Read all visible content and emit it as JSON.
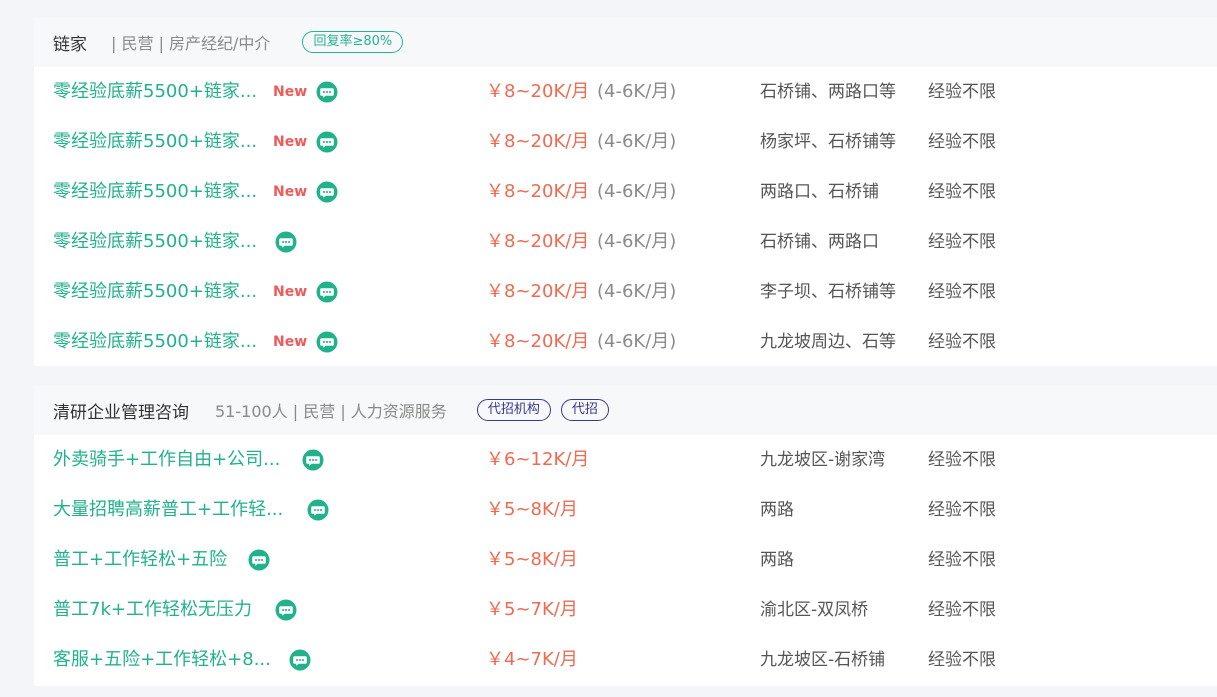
{
  "companies": [
    {
      "name": "链家",
      "info": "| 民营 | 房产经纪/中介",
      "tags": [
        "回复率≥80%"
      ],
      "jobs": [
        {
          "title": "零经验底薪5500+链家...",
          "new": "New",
          "salary": "￥8~20K/月",
          "salary_sub": "(4-6K/月)",
          "location": "石桥铺、两路口等",
          "experience": "经验不限"
        },
        {
          "title": "零经验底薪5500+链家...",
          "new": "New",
          "salary": "￥8~20K/月",
          "salary_sub": "(4-6K/月)",
          "location": "杨家坪、石桥铺等",
          "experience": "经验不限"
        },
        {
          "title": "零经验底薪5500+链家...",
          "new": "New",
          "salary": "￥8~20K/月",
          "salary_sub": "(4-6K/月)",
          "location": "两路口、石桥铺",
          "experience": "经验不限"
        },
        {
          "title": "零经验底薪5500+链家...",
          "new": "",
          "salary": "￥8~20K/月",
          "salary_sub": "(4-6K/月)",
          "location": "石桥铺、两路口",
          "experience": "经验不限"
        },
        {
          "title": "零经验底薪5500+链家...",
          "new": "New",
          "salary": "￥8~20K/月",
          "salary_sub": "(4-6K/月)",
          "location": "李子坝、石桥铺等",
          "experience": "经验不限"
        },
        {
          "title": "零经验底薪5500+链家...",
          "new": "New",
          "salary": "￥8~20K/月",
          "salary_sub": "(4-6K/月)",
          "location": "九龙坡周边、石等",
          "experience": "经验不限"
        }
      ]
    },
    {
      "name": "清研企业管理咨询",
      "info": "51-100人 | 民营 | 人力资源服务",
      "tags": [
        "代招机构",
        "代招"
      ],
      "jobs": [
        {
          "title": "外卖骑手+工作自由+公司...",
          "salary": "￥6~12K/月",
          "location": "九龙坡区-谢家湾",
          "experience": "经验不限"
        },
        {
          "title": "大量招聘高薪普工+工作轻...",
          "salary": "￥5~8K/月",
          "location": "两路",
          "experience": "经验不限"
        },
        {
          "title": "普工+工作轻松+五险",
          "salary": "￥5~8K/月",
          "location": "两路",
          "experience": "经验不限"
        },
        {
          "title": "普工7k+工作轻松无压力",
          "salary": "￥5~7K/月",
          "location": "渝北区-双凤桥",
          "experience": "经验不限"
        },
        {
          "title": "客服+五险+工作轻松+8...",
          "salary": "￥4~7K/月",
          "location": "九龙坡区-石桥铺",
          "experience": "经验不限"
        }
      ]
    }
  ],
  "icons": {
    "chat": "chat-bubble-icon"
  },
  "colors": {
    "title": "#22b28b",
    "salary": "#ef6a50",
    "new": "#ef5b5b",
    "tag_green": "#26b491",
    "tag_purple": "#3a3a8c"
  }
}
